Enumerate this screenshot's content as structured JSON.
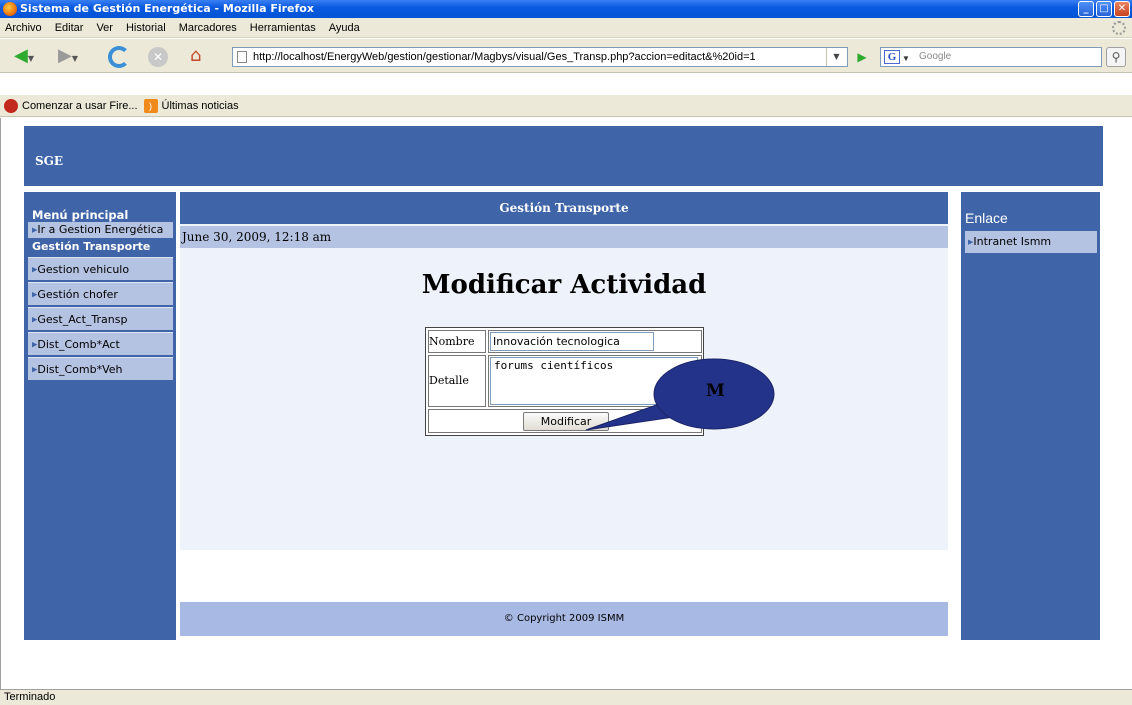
{
  "window": {
    "title": "Sistema de Gestión Energética - Mozilla Firefox"
  },
  "menu": [
    "Archivo",
    "Editar",
    "Ver",
    "Historial",
    "Marcadores",
    "Herramientas",
    "Ayuda"
  ],
  "nav": {
    "url": "http://localhost/EnergyWeb/gestion/gestionar/Magbys/visual/Ges_Transp.php?accion=editact&%20id=1",
    "search_placeholder": "Google"
  },
  "bookmarks": [
    "Comenzar a usar Fire...",
    "Últimas noticias"
  ],
  "site": {
    "header": "SGE"
  },
  "leftnav": {
    "heading": "Menú principal",
    "goto": "Ir a Gestion Energética",
    "section": "Gestión Transporte",
    "items": [
      "Gestion vehiculo",
      "Gestión chofer",
      "Gest_Act_Transp",
      "Dist_Comb*Act",
      "Dist_Comb*Veh"
    ]
  },
  "main": {
    "section_title": "Gestión Transporte",
    "date": "June 30, 2009, 12:18 am",
    "page_title": "Modificar Actividad",
    "form": {
      "nombre_label": "Nombre",
      "nombre_value": "Innovación tecnologica",
      "detalle_label": "Detalle",
      "detalle_value": "forums científicos",
      "submit_label": "Modificar"
    },
    "callout_label": "M"
  },
  "rightnav": {
    "title": "Enlace",
    "items": [
      "Intranet Ismm"
    ]
  },
  "footer": "© Copyright 2009 ISMM",
  "status": "Terminado",
  "colors": {
    "theme_blue": "#3f64a8",
    "light_blue": "#b5c3e3",
    "callout": "#24338a"
  }
}
